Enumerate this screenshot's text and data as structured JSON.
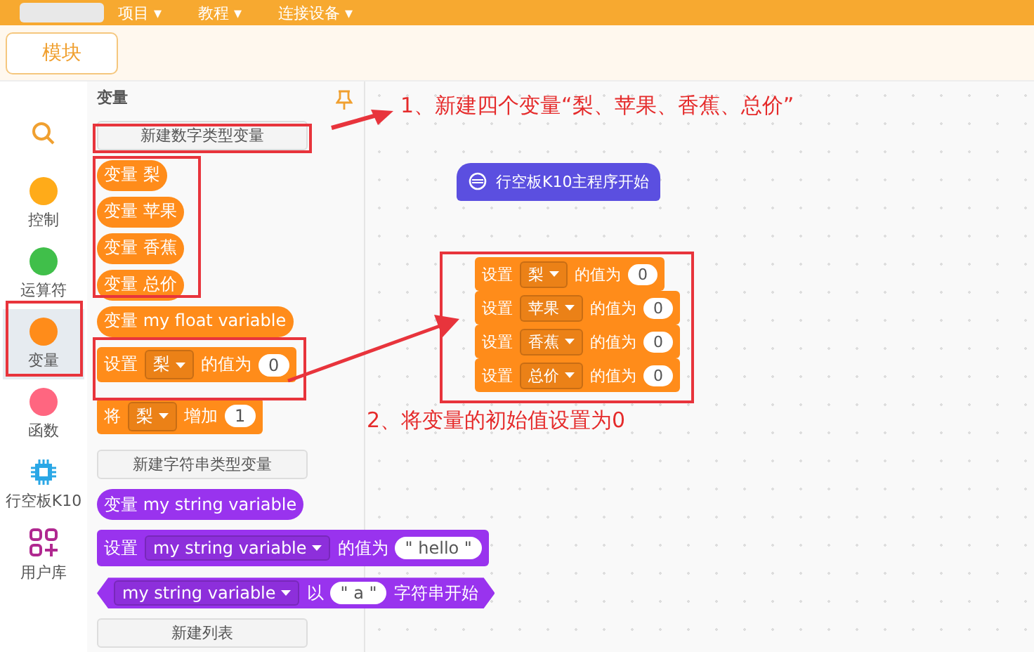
{
  "menu": [
    "项目 ▾",
    "教程 ▾",
    "连接设备 ▾"
  ],
  "tabs": [
    {
      "label": "模块",
      "selected": true
    }
  ],
  "categories": [
    {
      "kind": "search",
      "selected": false
    },
    {
      "kind": "dot",
      "label": "控制",
      "color": "#ffab19",
      "selected": false
    },
    {
      "kind": "dot",
      "label": "运算符",
      "color": "#40bf4a",
      "selected": false
    },
    {
      "kind": "dot",
      "label": "变量",
      "color": "#ff8c1a",
      "selected": true
    },
    {
      "kind": "dot",
      "label": "函数",
      "color": "#ff6680",
      "selected": false
    },
    {
      "kind": "chip",
      "label": "行空板K10",
      "selected": false
    },
    {
      "kind": "library",
      "label": "用户库",
      "selected": false
    }
  ],
  "palette": {
    "title": "变量",
    "blocks": [
      {
        "kind": "button",
        "label": "新建数字类型变量"
      },
      {
        "kind": "reporter",
        "color": "#ff8c1a",
        "parts": [
          {
            "text": "变量 梨"
          }
        ]
      },
      {
        "kind": "reporter",
        "color": "#ff8c1a",
        "parts": [
          {
            "text": "变量 苹果"
          }
        ]
      },
      {
        "kind": "reporter",
        "color": "#ff8c1a",
        "parts": [
          {
            "text": "变量 香蕉"
          }
        ]
      },
      {
        "kind": "reporter",
        "color": "#ff8c1a",
        "parts": [
          {
            "text": "变量 总价"
          }
        ]
      },
      {
        "kind": "reporter",
        "color": "#ff8c1a",
        "parts": [
          {
            "text": "变量 my float variable"
          }
        ]
      },
      {
        "kind": "stack",
        "color": "#ff8c1a",
        "parts": [
          {
            "text": "设置"
          },
          {
            "dropdown": "梨"
          },
          {
            "text": "的值为"
          },
          {
            "input": "0"
          }
        ]
      },
      {
        "kind": "stack",
        "color": "#ff8c1a",
        "parts": [
          {
            "text": "将"
          },
          {
            "dropdown": "梨"
          },
          {
            "text": "增加"
          },
          {
            "input": "1"
          }
        ]
      },
      {
        "kind": "button",
        "label": "新建字符串类型变量"
      },
      {
        "kind": "reporter",
        "color": "#9933ee",
        "parts": [
          {
            "text": "变量 my string variable"
          }
        ]
      },
      {
        "kind": "stack",
        "color": "#9933ee",
        "parts": [
          {
            "text": "设置"
          },
          {
            "dropdown": "my string variable"
          },
          {
            "text": "的值为"
          },
          {
            "input": "\" hello \""
          }
        ]
      },
      {
        "kind": "boolean",
        "color": "#9933ee",
        "parts": [
          {
            "dropdown": "my string variable"
          },
          {
            "text": "以"
          },
          {
            "input": "\" a \""
          },
          {
            "text": "字符串开始"
          }
        ]
      },
      {
        "kind": "button",
        "label": "新建列表"
      }
    ]
  },
  "canvas": {
    "hat": {
      "text": "行空板K10主程序开始"
    },
    "stack": [
      {
        "parts": [
          {
            "text": "设置"
          },
          {
            "dropdown": "梨"
          },
          {
            "text": "的值为"
          },
          {
            "input": "0"
          }
        ]
      },
      {
        "parts": [
          {
            "text": "设置"
          },
          {
            "dropdown": "苹果"
          },
          {
            "text": "的值为"
          },
          {
            "input": "0"
          }
        ]
      },
      {
        "parts": [
          {
            "text": "设置"
          },
          {
            "dropdown": "香蕉"
          },
          {
            "text": "的值为"
          },
          {
            "input": "0"
          }
        ]
      },
      {
        "parts": [
          {
            "text": "设置"
          },
          {
            "dropdown": "总价"
          },
          {
            "text": "的值为"
          },
          {
            "input": "0"
          }
        ]
      }
    ]
  },
  "annotations": [
    {
      "text": "1、新建四个变量“梨、苹果、香蕉、总价”"
    },
    {
      "text": "2、将变量的初始值设置为0"
    }
  ]
}
